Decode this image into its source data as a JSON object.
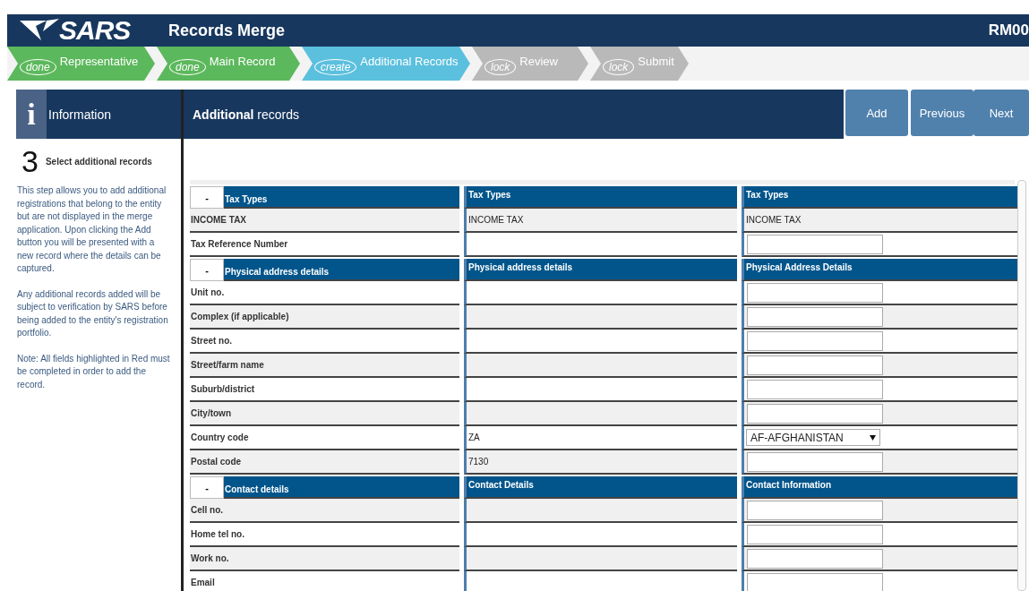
{
  "header": {
    "logo": "SARS",
    "title": "Records Merge",
    "code": "RM00"
  },
  "steps": [
    {
      "badge": "done",
      "label": "Representative",
      "kind": "done"
    },
    {
      "badge": "done",
      "label": "Main Record",
      "kind": "done"
    },
    {
      "badge": "create",
      "label": "Additional Records",
      "kind": "current"
    },
    {
      "badge": "lock",
      "label": "Review",
      "kind": "locked"
    },
    {
      "badge": "lock",
      "label": "Submit",
      "kind": "locked"
    }
  ],
  "info": {
    "title": "Information",
    "icon": "i",
    "step_number": "3",
    "step_title": "Select additional records",
    "paragraphs": [
      "This step allows you to add additional registrations that belong to the entity but are not displayed in the merge application. Upon clicking the Add button you will be presented with a new record where the details can be captured.",
      "Any additional records added will be subject to verification by SARS before being added to the entity's registration portfolio.",
      "Note: All fields highlighted in Red must be completed in order to add the record."
    ]
  },
  "main": {
    "title": "**Additional** records",
    "buttons": [
      "Add",
      "Previous",
      "Next"
    ]
  },
  "sections": [
    {
      "toggle": "-",
      "title": "Tax Types",
      "title_2": "Tax Types",
      "title_3": "Tax Types",
      "rows": [
        {
          "label": "INCOME TAX",
          "value_2": "INCOME TAX",
          "kind": "text",
          "value_3": "INCOME TAX",
          "shaded": true
        },
        {
          "label": "Tax Reference Number",
          "kind": "input",
          "shaded": false
        }
      ]
    },
    {
      "toggle": "-",
      "title": "Physical address details",
      "title_2": "Physical address details",
      "title_3": "Physical Address Details",
      "rows": [
        {
          "label": "Unit no.",
          "kind": "input",
          "shaded": false
        },
        {
          "label": "Complex (if applicable)",
          "kind": "input",
          "shaded": true
        },
        {
          "label": "Street no.",
          "kind": "input",
          "shaded": false
        },
        {
          "label": "Street/farm name",
          "kind": "input",
          "shaded": true
        },
        {
          "label": "Suburb/district",
          "kind": "input",
          "shaded": false
        },
        {
          "label": "City/town",
          "kind": "input",
          "shaded": true
        },
        {
          "label": "Country code",
          "value_2": "ZA",
          "kind": "select",
          "value_3": "AF-AFGHANISTAN",
          "shaded": false
        },
        {
          "label": "Postal code",
          "value_2": "7130",
          "kind": "input",
          "shaded": true
        }
      ]
    },
    {
      "toggle": "-",
      "title": "Contact details",
      "title_2": "Contact Details",
      "title_3": "Contact Information",
      "rows": [
        {
          "label": "Cell no.",
          "kind": "input",
          "shaded": true
        },
        {
          "label": "Home tel no.",
          "kind": "input",
          "shaded": false
        },
        {
          "label": "Work no.",
          "kind": "input",
          "shaded": true
        },
        {
          "label": "Email",
          "kind": "input",
          "shaded": false
        }
      ]
    }
  ]
}
